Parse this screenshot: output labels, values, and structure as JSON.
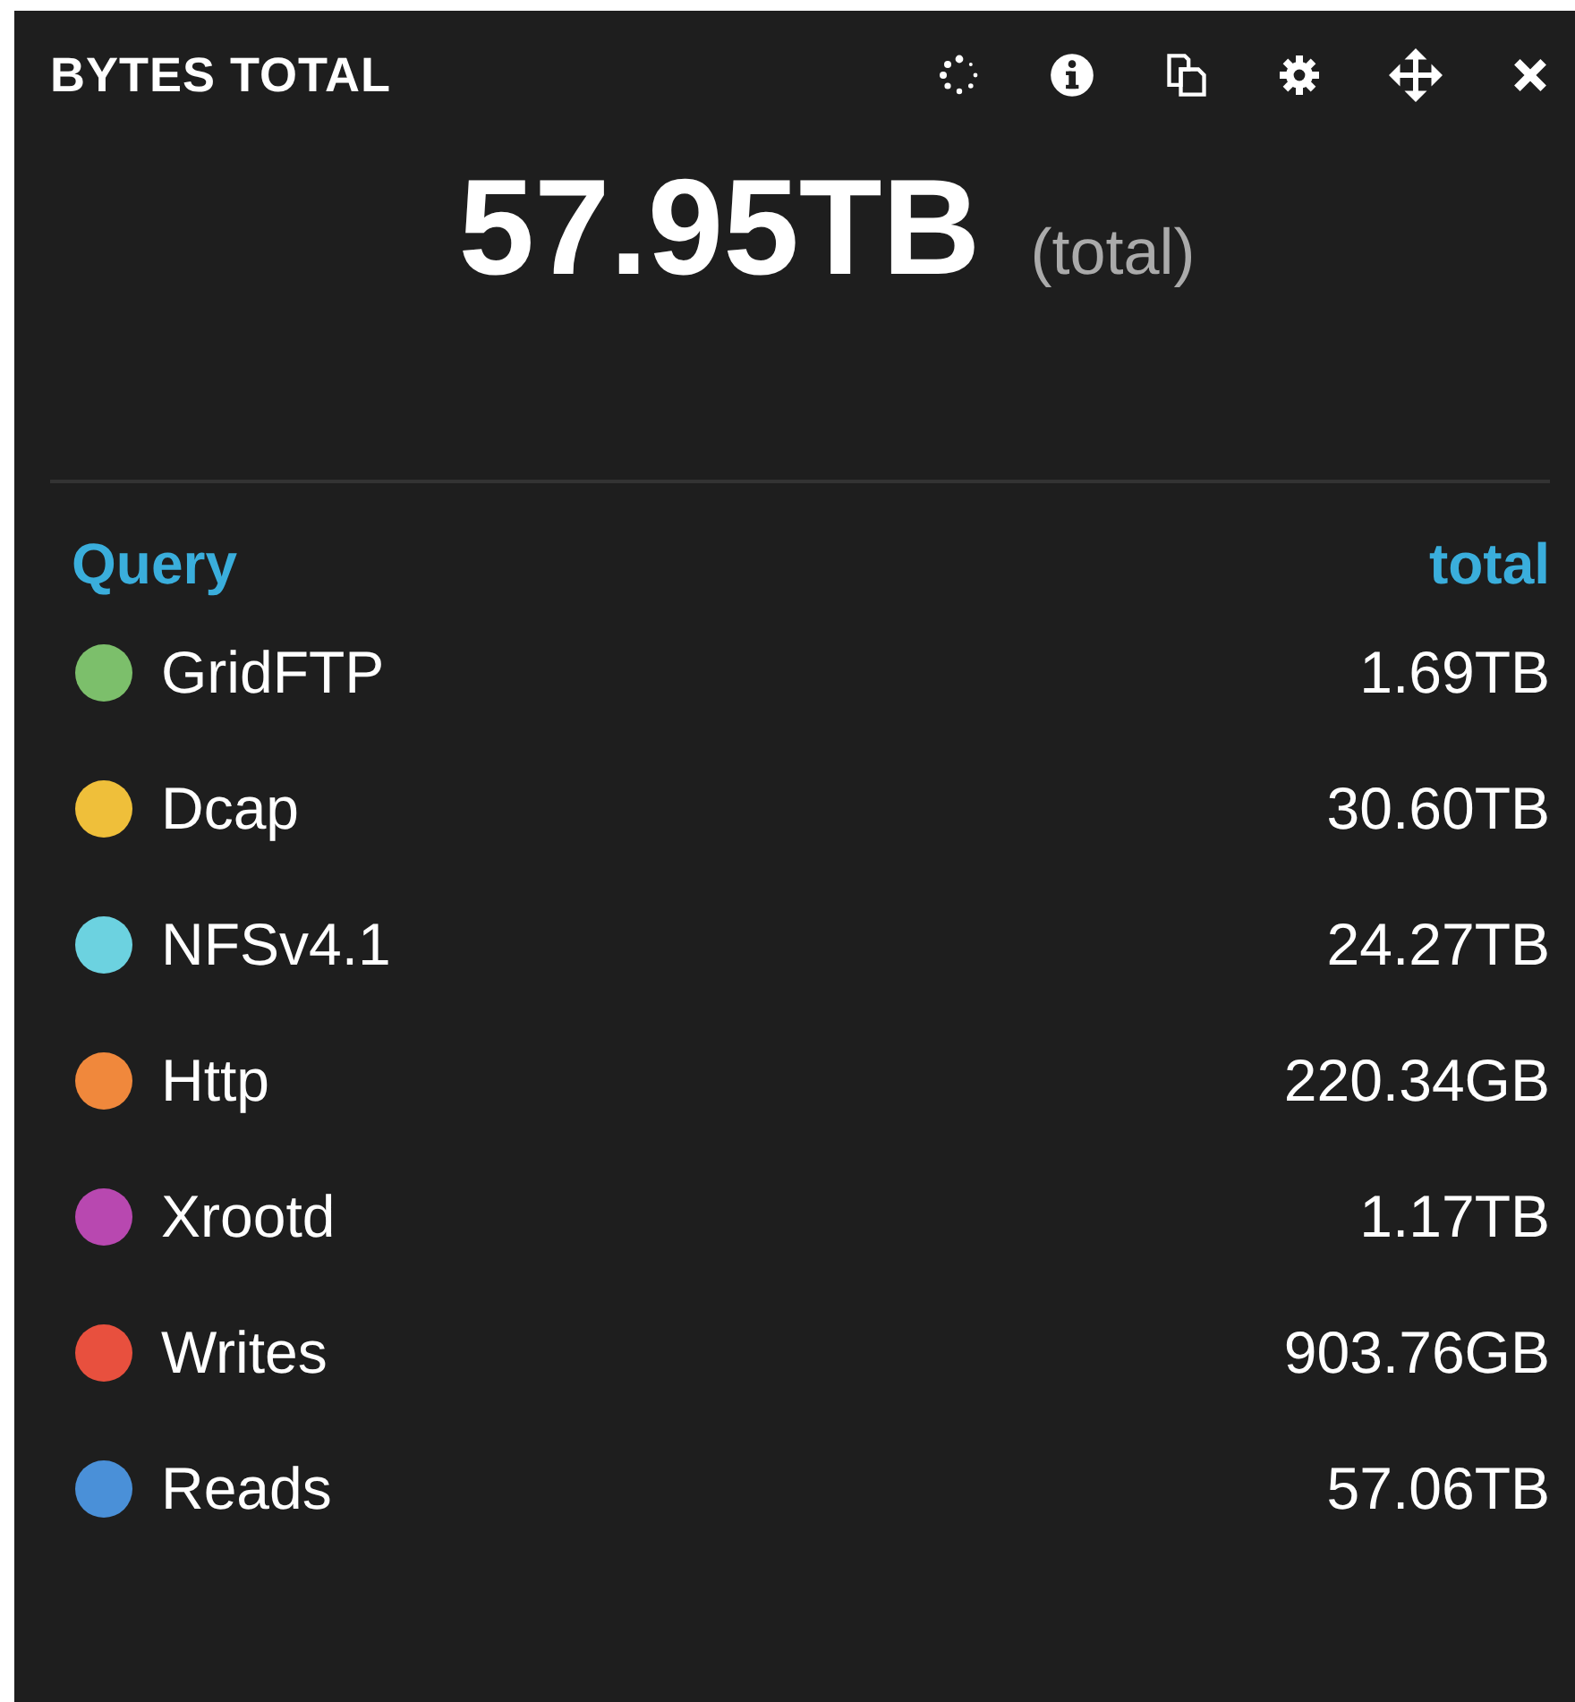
{
  "panel": {
    "title": "BYTES TOTAL"
  },
  "summary": {
    "value": "57.95TB",
    "unit": "(total)"
  },
  "table": {
    "columns": [
      "Query",
      "total"
    ],
    "rows": [
      {
        "name": "GridFTP",
        "value": "1.69TB",
        "color": "#7cbf6b"
      },
      {
        "name": "Dcap",
        "value": "30.60TB",
        "color": "#efbf3a"
      },
      {
        "name": "NFSv4.1",
        "value": "24.27TB",
        "color": "#6cd2e0"
      },
      {
        "name": "Http",
        "value": "220.34GB",
        "color": "#f0883c"
      },
      {
        "name": "Xrootd",
        "value": "1.17TB",
        "color": "#b848b0"
      },
      {
        "name": "Writes",
        "value": "903.76GB",
        "color": "#e8503e"
      },
      {
        "name": "Reads",
        "value": "57.06TB",
        "color": "#4a90d8"
      }
    ]
  }
}
